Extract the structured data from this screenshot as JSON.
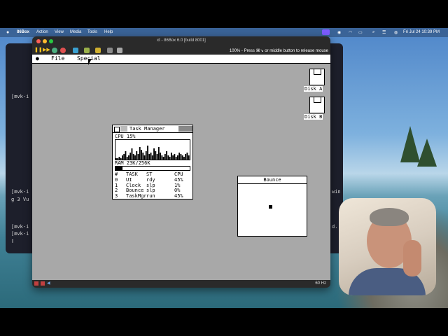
{
  "mac_menubar": {
    "app": "86Box",
    "items": [
      "Action",
      "View",
      "Media",
      "Tools",
      "Help"
    ],
    "clock": "Fri Jul 24  10:39 PM"
  },
  "terminal": {
    "lines": [
      "[mvk-i",
      "[mvk-i",
      "g 3 Vu",
      "[mvk-i",
      "[mvk-i"
    ],
    "right_fragments": [
      "win",
      "d."
    ]
  },
  "emulator": {
    "title": "xt - 86Box 6.0 [build 8001]",
    "hint": "100% - Press ⌘↘ or middle button to release mouse",
    "status_rate": "60 Hz",
    "toolbar_icons": [
      "pause-icon",
      "fast-forward-icon",
      "reset-icon",
      "power-icon",
      "settings-icon",
      "screenshot-icon",
      "clipboard-icon"
    ]
  },
  "gem": {
    "menu": [
      "File",
      "Special"
    ],
    "disks": [
      {
        "label": "Disk A"
      },
      {
        "label": "Disk B"
      }
    ]
  },
  "task_manager": {
    "title": "Task Manager",
    "cpu_label": "CPU  15%",
    "cpu_history": [
      1,
      1,
      2,
      1,
      3,
      4,
      6,
      2,
      3,
      5,
      8,
      4,
      3,
      6,
      4,
      9,
      7,
      5,
      3,
      6,
      10,
      4,
      5,
      3,
      8,
      6,
      4,
      9,
      5,
      3,
      2,
      4,
      6,
      3,
      2,
      5,
      3,
      4,
      2,
      3,
      5,
      4,
      3,
      2,
      4,
      5,
      3
    ],
    "ram_label": "RAM  23K/256K",
    "ram_fraction": 0.09,
    "columns": [
      "#",
      "TASK",
      "ST",
      "CPU"
    ],
    "rows": [
      {
        "id": "0",
        "task": "UI",
        "state": "rdy",
        "cpu": "45%"
      },
      {
        "id": "1",
        "task": "Clock",
        "state": "slp",
        "cpu": "1%"
      },
      {
        "id": "2",
        "task": "Bounce",
        "state": "slp",
        "cpu": "0%"
      },
      {
        "id": "3",
        "task": "TaskMgr",
        "state": "run",
        "cpu": "45%"
      }
    ]
  },
  "bounce": {
    "title": "Bounce"
  },
  "colors": {
    "screen_bg": "#a8a8a8",
    "mac_accent": "#7b5cff"
  }
}
